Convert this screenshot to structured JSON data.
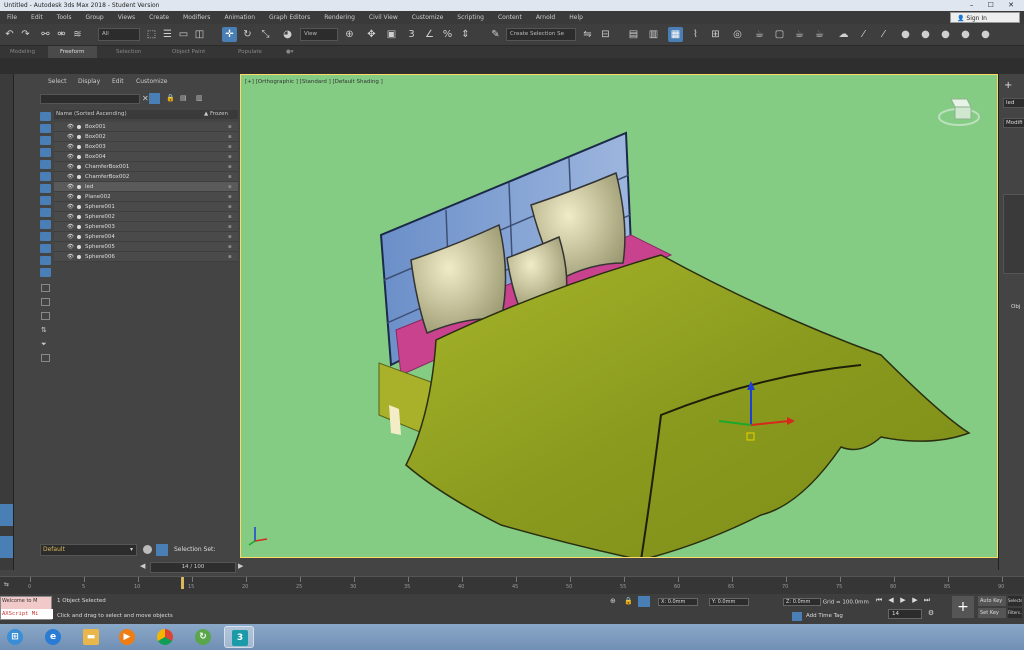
{
  "window": {
    "title": "Untitled - Autodesk 3ds Max 2018 - Student Version",
    "controls": "– ☐ ✕"
  },
  "menu": [
    "File",
    "Edit",
    "Tools",
    "Group",
    "Views",
    "Create",
    "Modifiers",
    "Animation",
    "Graph Editors",
    "Rendering",
    "Civil View",
    "Customize",
    "Scripting",
    "Content",
    "Arnold",
    "Help"
  ],
  "signin": "Sign In",
  "toolbar": {
    "filter_value": "All",
    "view_value": "View",
    "selection_set_value": "Create Selection Se"
  },
  "ribbon": {
    "tabs": [
      "Modeling",
      "Freeform",
      "Selection",
      "Object Paint",
      "Populate"
    ],
    "active": "Freeform"
  },
  "explorer": {
    "menu": [
      "Select",
      "Display",
      "Edit",
      "Customize"
    ],
    "column_name": "Name (Sorted Ascending)",
    "column_frozen": "▲ Frozen",
    "objects": [
      {
        "name": "Box001",
        "selected": false
      },
      {
        "name": "Box002",
        "selected": false
      },
      {
        "name": "Box003",
        "selected": false
      },
      {
        "name": "Box004",
        "selected": false
      },
      {
        "name": "ChamferBox001",
        "selected": false
      },
      {
        "name": "ChamferBox002",
        "selected": false
      },
      {
        "name": "led",
        "selected": true
      },
      {
        "name": "Plane002",
        "selected": false
      },
      {
        "name": "Sphere001",
        "selected": false
      },
      {
        "name": "Sphere002",
        "selected": false
      },
      {
        "name": "Sphere003",
        "selected": false
      },
      {
        "name": "Sphere004",
        "selected": false
      },
      {
        "name": "Sphere005",
        "selected": false
      },
      {
        "name": "Sphere006",
        "selected": false
      }
    ],
    "layer": "Default",
    "selection_set_label": "Selection Set:"
  },
  "viewport": {
    "label": "[+] [Orthographic ] [Standard ] [Default Shading ]",
    "background": "#84cc83"
  },
  "command_panel": {
    "name_value": "led",
    "modifier_label": "Modifi",
    "object_label": "Obj"
  },
  "timeline": {
    "frame_display": "14 / 100",
    "ticks": [
      "0",
      "5",
      "10",
      "15",
      "20",
      "25",
      "30",
      "35",
      "40",
      "45",
      "50",
      "55",
      "60",
      "65",
      "70",
      "75",
      "80",
      "85",
      "90",
      "95",
      "100"
    ],
    "current_frame": 14
  },
  "status": {
    "maxscript_line": "Welcome to M",
    "maxscript_input": "AXScript Mi",
    "selection": "1 Object Selected",
    "prompt": "Click and drag to select and move objects",
    "x": "X: 0.0mm",
    "y": "Y: 0.0mm",
    "z": "Z: 0.0mm",
    "grid": "Grid = 100.0mm",
    "add_time_tag": "Add Time Tag",
    "auto_key": "Auto Key",
    "set_key": "Set Key",
    "frame": "14",
    "selected_label": "Selected",
    "filters_label": "Filters..."
  },
  "taskbar": {
    "apps": [
      "start",
      "ie",
      "explorer",
      "media",
      "chrome",
      "app",
      "3dsmax"
    ]
  }
}
